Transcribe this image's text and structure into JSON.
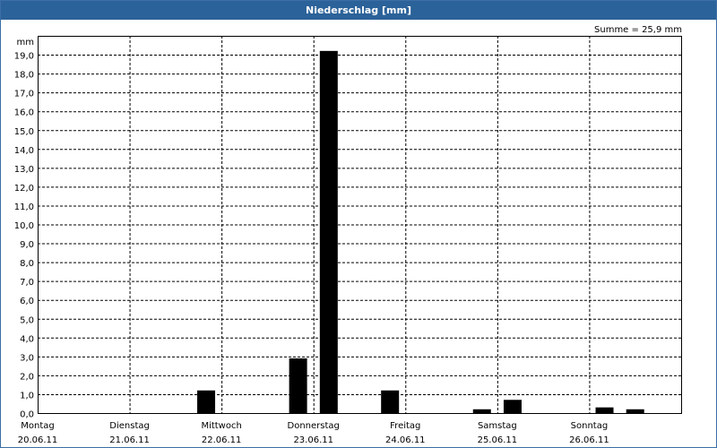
{
  "title": "Niederschlag [mm]",
  "summary": "Summe = 25,9 mm",
  "colors": {
    "title_bar": "#2b6299",
    "bar": "#000000",
    "grid": "#000000"
  },
  "chart_data": {
    "type": "bar",
    "title": "Niederschlag [mm]",
    "ylabel": "mm",
    "ylim": [
      0,
      20
    ],
    "grid": true,
    "y_ticks": [
      "0,0",
      "1,0",
      "2,0",
      "3,0",
      "4,0",
      "5,0",
      "6,0",
      "7,0",
      "8,0",
      "9,0",
      "10,0",
      "11,0",
      "12,0",
      "13,0",
      "14,0",
      "15,0",
      "16,0",
      "17,0",
      "18,0",
      "19,0"
    ],
    "days": [
      {
        "name": "Montag",
        "date": "20.06.11"
      },
      {
        "name": "Dienstag",
        "date": "21.06.11"
      },
      {
        "name": "Mittwoch",
        "date": "22.06.11"
      },
      {
        "name": "Donnerstag",
        "date": "23.06.11"
      },
      {
        "name": "Freitag",
        "date": "24.06.11"
      },
      {
        "name": "Samstag",
        "date": "25.06.11"
      },
      {
        "name": "Sonntag",
        "date": "26.06.11"
      }
    ],
    "interval_hours": 8,
    "values": [
      0,
      0,
      0,
      0,
      0,
      1.2,
      0,
      0,
      2.9,
      19.2,
      0,
      1.2,
      0,
      0,
      0.2,
      0.7,
      0,
      0,
      0.3,
      0.2,
      0
    ]
  }
}
